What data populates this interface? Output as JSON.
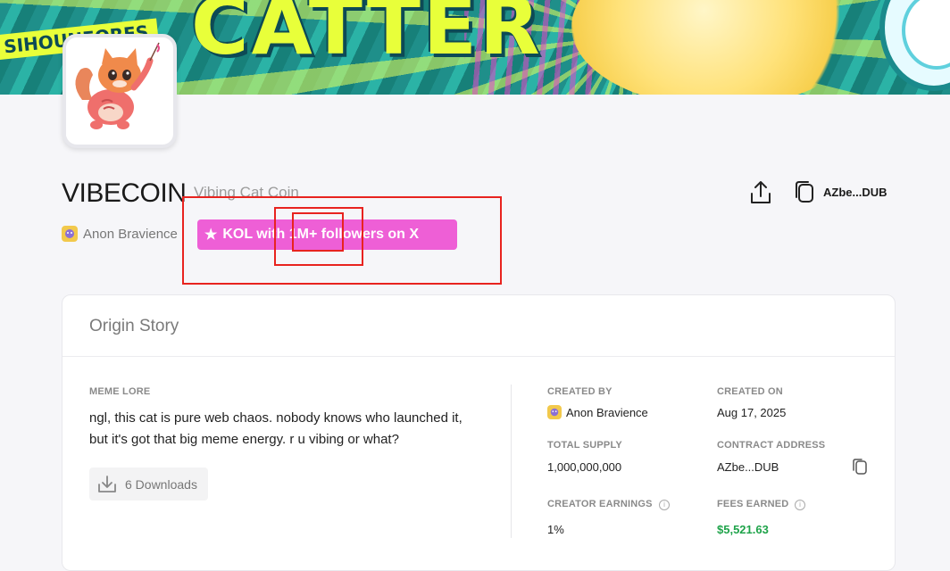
{
  "banner": {
    "art_title": "CATTER",
    "art_side_text": "SIHOUNEORES"
  },
  "coin": {
    "name": "VIBECOIN",
    "subtitle": "Vibing Cat Coin",
    "creator": "Anon Bravience",
    "badge": "KOL with 1M+ followers on X",
    "address_short": "AZbe...DUB"
  },
  "origin_story": {
    "title": "Origin Story",
    "meme_lore_label": "MEME LORE",
    "meme_lore_text": "ngl, this cat is pure web chaos. nobody knows who launched it, but it's got that big meme energy. r u vibing or what?",
    "downloads_label": "6 Downloads",
    "created_by_label": "CREATED BY",
    "created_by_value": "Anon Bravience",
    "created_on_label": "CREATED ON",
    "created_on_value": "Aug 17, 2025",
    "total_supply_label": "TOTAL SUPPLY",
    "total_supply_value": "1,000,000,000",
    "contract_address_label": "CONTRACT ADDRESS",
    "contract_address_value": "AZbe...DUB",
    "creator_earnings_label": "CREATOR EARNINGS",
    "creator_earnings_value": "1%",
    "fees_earned_label": "FEES EARNED",
    "fees_earned_value": "$5,521.63"
  },
  "colors": {
    "badge_pink": "#ee5fd6",
    "annotation_red": "#e8231f",
    "fees_green": "#1fa34a"
  }
}
